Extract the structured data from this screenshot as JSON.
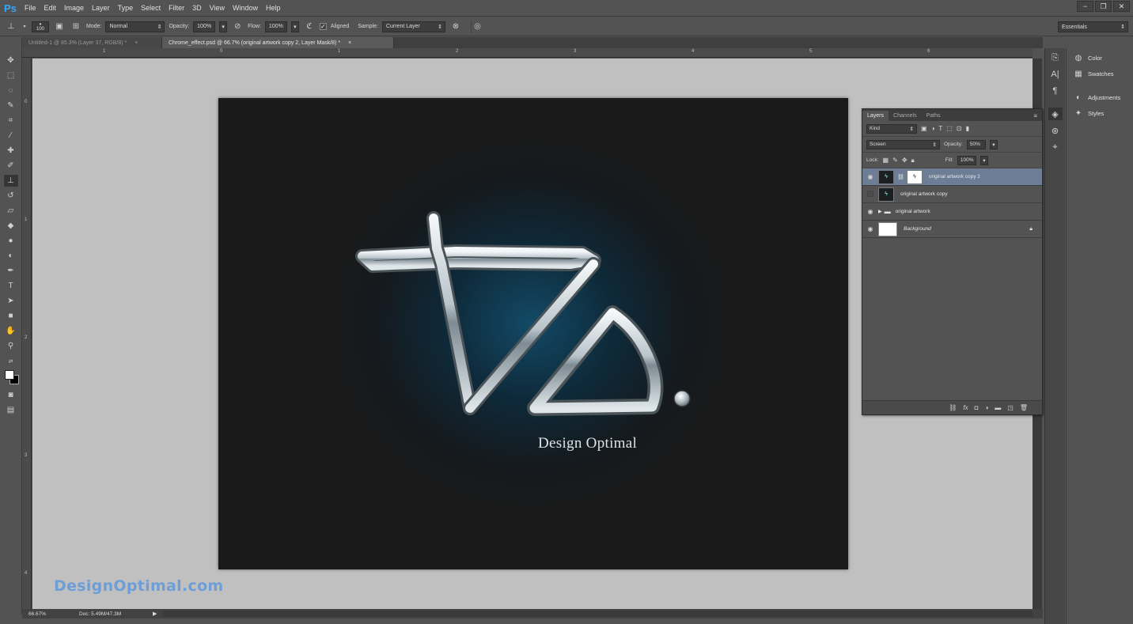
{
  "menubar": {
    "logo": "Ps",
    "items": [
      "File",
      "Edit",
      "Image",
      "Layer",
      "Type",
      "Select",
      "Filter",
      "3D",
      "View",
      "Window",
      "Help"
    ],
    "win_controls": [
      "−",
      "❐",
      "✕"
    ]
  },
  "options": {
    "brush_size": "100",
    "mode_label": "Mode:",
    "mode_value": "Normal",
    "opacity_label": "Opacity:",
    "opacity_value": "100%",
    "flow_label": "Flow:",
    "flow_value": "100%",
    "aligned_label": "Aligned",
    "sample_label": "Sample:",
    "sample_value": "Current Layer",
    "workspace": "Essentials"
  },
  "tabs": [
    {
      "label": "Untitled-1 @ 85.3% (Layer 37, RGB/8) *",
      "close": "×"
    },
    {
      "label": "Chrome_effect.psd @ 66.7% (original artwork copy 2, Layer Mask/8) *",
      "close": "×"
    }
  ],
  "ruler": {
    "top": [
      "1",
      "0",
      "1",
      "2",
      "3",
      "4",
      "5",
      "6"
    ],
    "left": [
      "0",
      "1",
      "2",
      "3",
      "4"
    ]
  },
  "canvas": {
    "logo_text": "Design Optimal",
    "watermark": "DesignOptimal.com",
    "colors": {
      "glow": "#134a66",
      "background": "#1a1a1a",
      "pasteboard": "#c0c0c0"
    }
  },
  "status": {
    "zoom": "66.67%",
    "doc": "Doc: 5.49M/47.3M"
  },
  "right_panel": {
    "items": [
      {
        "label": "Color",
        "icon": "color-wheel-icon"
      },
      {
        "label": "Swatches",
        "icon": "swatches-grid-icon"
      },
      {
        "label": "Adjustments",
        "icon": "adjustments-icon"
      },
      {
        "label": "Styles",
        "icon": "styles-icon"
      }
    ]
  },
  "layers_panel": {
    "tabs": [
      "Layers",
      "Channels",
      "Paths"
    ],
    "filter_kind": "Kind",
    "blend_mode": "Screen",
    "opacity_label": "Opacity:",
    "opacity_value": "50%",
    "lock_label": "Lock:",
    "fill_label": "Fill:",
    "fill_value": "100%",
    "layers": [
      {
        "name": "original artwork copy 2",
        "visible": true,
        "selected": true
      },
      {
        "name": "original artwork copy",
        "visible": false,
        "selected": false
      },
      {
        "name": "original artwork",
        "visible": true,
        "selected": false
      },
      {
        "name": "Background",
        "visible": true,
        "selected": false
      }
    ]
  }
}
